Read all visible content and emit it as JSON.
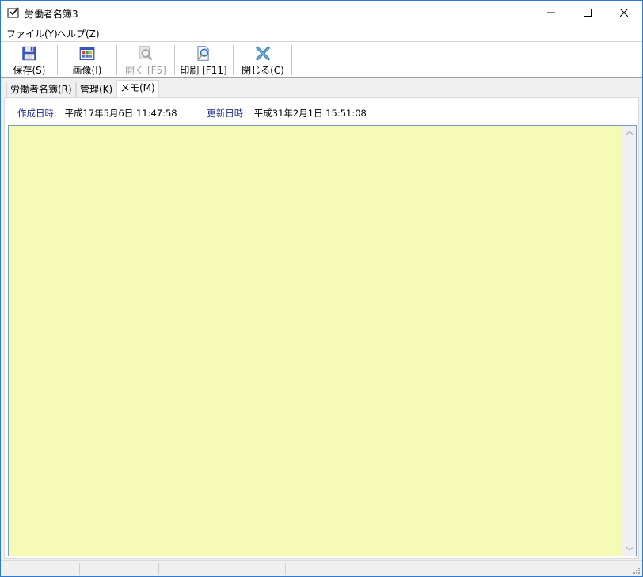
{
  "window": {
    "title": "労働者名簿3",
    "minimize_icon": "minimize-icon",
    "maximize_icon": "maximize-icon",
    "close_icon": "close-icon"
  },
  "menu": {
    "file": "ファイル(Y)",
    "help": "ヘルプ(Z)"
  },
  "toolbar": {
    "save": "保存(S)",
    "image": "画像(I)",
    "open": "開く [F5]",
    "print": "印刷 [F11]",
    "close": "閉じる(C)"
  },
  "tabs": [
    {
      "label": "労働者名簿(R)"
    },
    {
      "label": "管理(K)"
    },
    {
      "label": "メモ(M)"
    }
  ],
  "active_tab": "メモ(M)",
  "info": {
    "created_label": "作成日時:",
    "created_value": "平成17年5月6日  11:47:58",
    "updated_label": "更新日時:",
    "updated_value": "平成31年2月1日  15:51:08"
  },
  "memo": {
    "value": ""
  },
  "colors": {
    "memo_background": "#f5fbb4",
    "info_label": "#1a2a8c",
    "window_border": "#2b79d0"
  }
}
